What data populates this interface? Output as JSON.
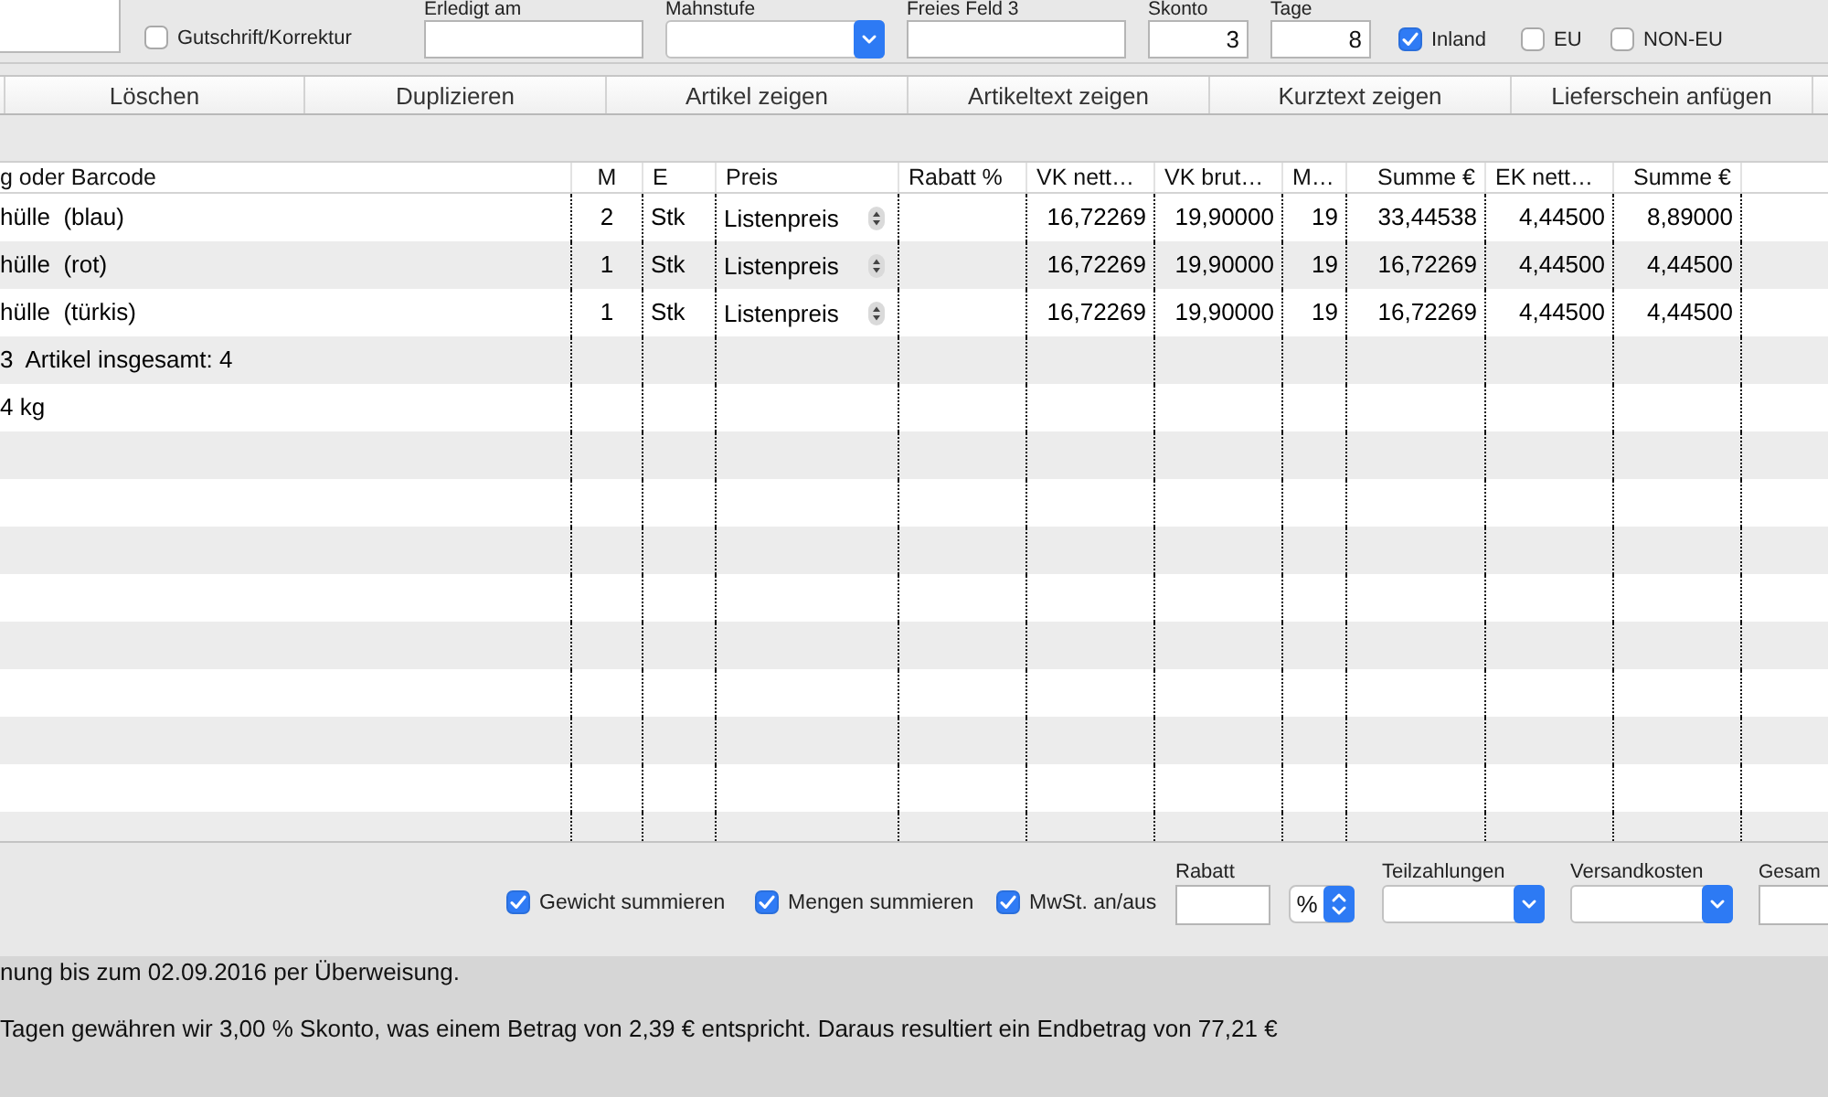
{
  "header_form": {
    "credit_note": {
      "label": "Gutschrift/Korrektur",
      "checked": false
    },
    "fields": [
      {
        "kind": "input",
        "label": "Erledigt am"
      },
      {
        "kind": "dropdown",
        "label": "Mahnstufe"
      },
      {
        "kind": "input",
        "label": "Freies Feld 3"
      },
      {
        "kind": "input",
        "label": "Skonto",
        "value": "3"
      },
      {
        "kind": "input",
        "label": "Tage",
        "value": "8"
      }
    ],
    "regions": [
      {
        "label": "Inland",
        "checked": true
      },
      {
        "label": "EU",
        "checked": false
      },
      {
        "label": "NON-EU",
        "checked": false
      }
    ]
  },
  "toolbar": [
    "Löschen",
    "Duplizieren",
    "Artikel zeigen",
    "Artikeltext zeigen",
    "Kurztext zeigen",
    "Lieferschein anfügen"
  ],
  "table": {
    "columns": [
      "g oder Barcode",
      "M",
      "E",
      "Preis",
      "Rabatt %",
      "VK nett…",
      "VK brut…",
      "M…",
      "Summe €",
      "EK nett…",
      "Summe €"
    ],
    "rows": [
      {
        "item": "hülle  (blau)",
        "quantity": "2",
        "unit": "Stk",
        "price_type": "Listenpreis",
        "vk_net": "16,72269",
        "vk_gross": "19,90000",
        "vat": "19",
        "total": "33,44538",
        "ek_net": "4,44500",
        "ek_total": "8,89000"
      },
      {
        "item": "hülle  (rot)",
        "quantity": "1",
        "unit": "Stk",
        "price_type": "Listenpreis",
        "vk_net": "16,72269",
        "vk_gross": "19,90000",
        "vat": "19",
        "total": "16,72269",
        "ek_net": "4,44500",
        "ek_total": "4,44500"
      },
      {
        "item": "hülle  (türkis)",
        "quantity": "1",
        "unit": "Stk",
        "price_type": "Listenpreis",
        "vk_net": "16,72269",
        "vk_gross": "19,90000",
        "vat": "19",
        "total": "16,72269",
        "ek_net": "4,44500",
        "ek_total": "4,44500"
      }
    ],
    "totals": [
      "3  Artikel insgesamt: 4",
      "4 kg"
    ]
  },
  "footer": {
    "checkboxes": [
      {
        "label": "Gewicht summieren",
        "checked": true
      },
      {
        "label": "Mengen summieren",
        "checked": true
      },
      {
        "label": "MwSt. an/aus",
        "checked": true
      }
    ],
    "fields": [
      {
        "kind": "input",
        "label": "Rabatt"
      },
      {
        "kind": "unit_popup",
        "value": "%"
      },
      {
        "kind": "dropdown",
        "label": "Teilzahlungen"
      },
      {
        "kind": "dropdown",
        "label": "Versandkosten"
      },
      {
        "kind": "input",
        "label": "Gesam"
      }
    ]
  },
  "notes": [
    "nung bis zum 02.09.2016 per Überweisung.",
    "Tagen gewähren wir 3,00 % Skonto, was einem Betrag von 2,39 € entspricht. Daraus resultiert ein Endbetrag von 77,21 €"
  ]
}
